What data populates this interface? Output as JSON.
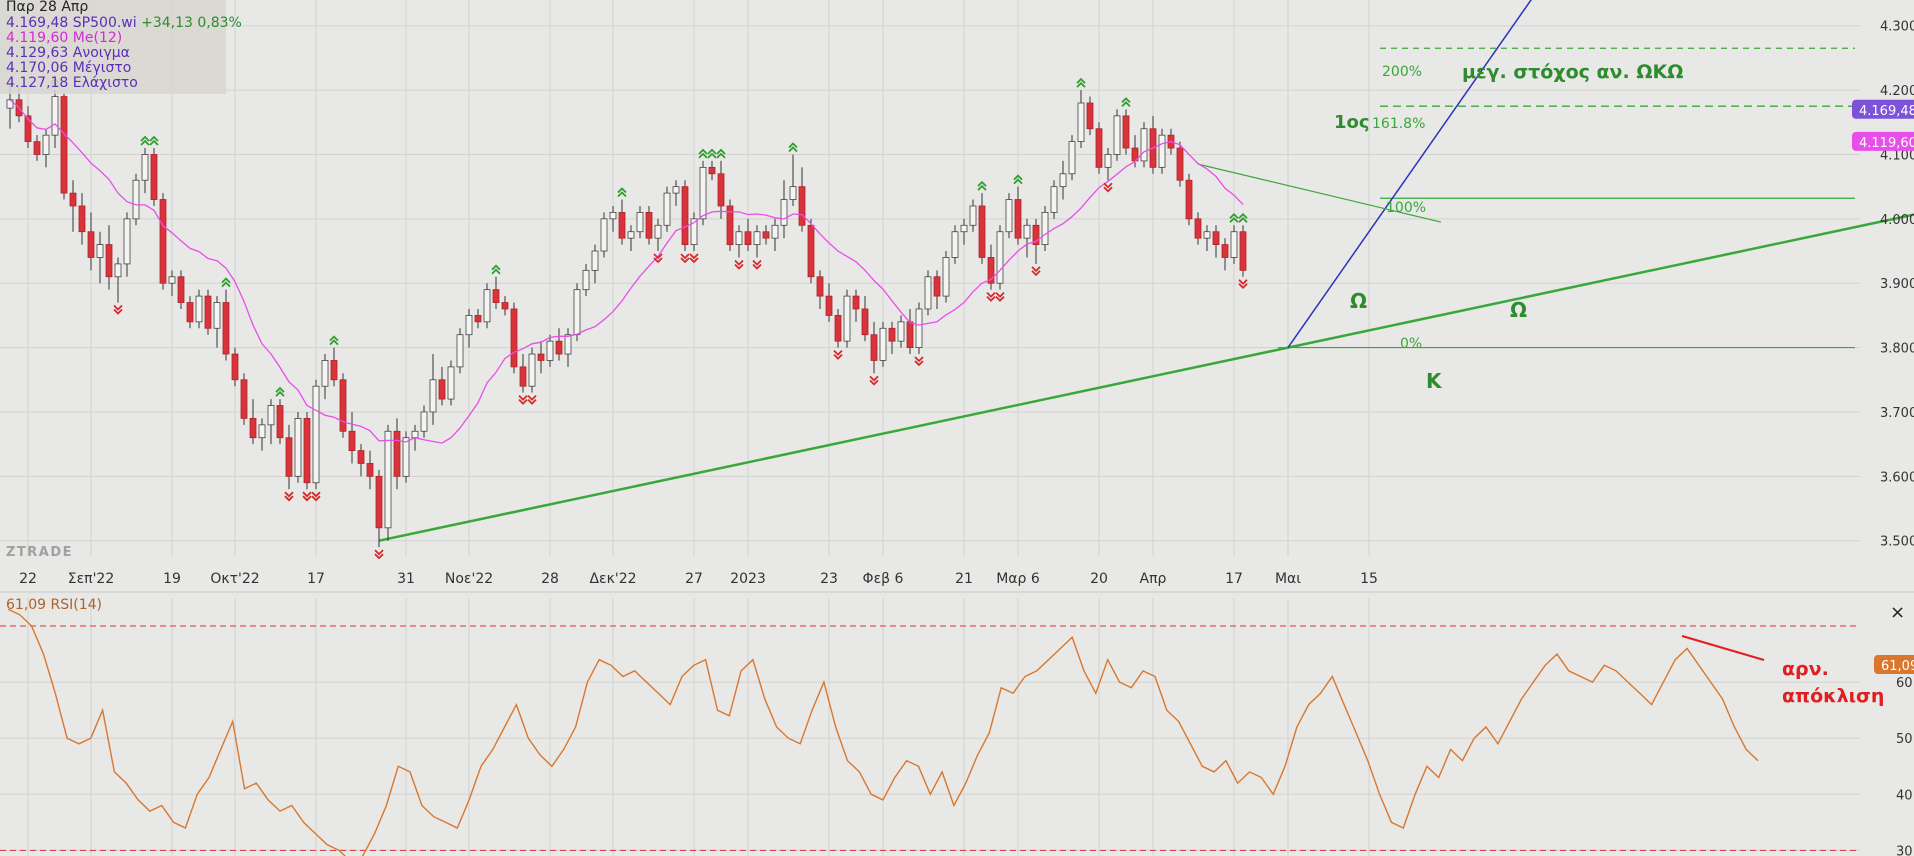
{
  "legend": {
    "date": "Παρ 28 Απρ",
    "price_line": "4.169,48 SP500.wi",
    "change": "+34,13 0,83%",
    "ma_line": "4.119,60 Me(12)",
    "open_line": "4.129,63 Ανοιγμα",
    "high_line": "4.170,06 Μέγιστο",
    "low_line": "4.127,18 Ελάχιστο"
  },
  "watermark": "ZTRADE",
  "price_badges": {
    "last": "4.169,48",
    "ma": "4.119,60"
  },
  "rsi": {
    "label": "61,09 RSI(14)",
    "badge": "61,09"
  },
  "annotations": {
    "target_label": "μεγ. στόχος αν. ΩΚΩ",
    "fib_200": "200%",
    "fib_1618_prefix": "1ος",
    "fib_1618": "161.8%",
    "fib_100": "100%",
    "fib_0": "0%",
    "omega_left": "Ω",
    "omega_right": "Ω",
    "k_label": "Κ",
    "divergence_line1": "αρν.",
    "divergence_line2": "απόκλιση"
  },
  "colors": {
    "background": "#e8e8e6",
    "bull_candle": "#f4f4f2",
    "bear_candle": "#d9343b",
    "ma": "#e84fe8",
    "rsi": "#d9772e",
    "trend_green": "#3aa73a",
    "trend_blue": "#2a34b8",
    "annotation_green": "#2e8b2e",
    "annotation_red": "#e02020",
    "badge_purple": "#7b52d8",
    "badge_pink": "#e84fe8",
    "badge_orange": "#d9772e"
  },
  "chart_data": [
    {
      "type": "candlestick",
      "series_label": "SP500.wi",
      "y_ticks": [
        "3.500",
        "3.600",
        "3.700",
        "3.800",
        "3.900",
        "4.000",
        "4.100",
        "4.200",
        "4.300"
      ],
      "y_tick_values": [
        3500,
        3600,
        3700,
        3800,
        3900,
        4000,
        4100,
        4200,
        4300
      ],
      "ylim": [
        3470,
        4340
      ],
      "x_ticks": [
        "22",
        "Σεπ'22",
        "19",
        "Οκτ'22",
        "17",
        "31",
        "Νοε'22",
        "28",
        "Δεκ'22",
        "27",
        "2023",
        "23",
        "Φεβ 6",
        "21",
        "Μαρ 6",
        "20",
        "Απρ",
        "17",
        "Μαι",
        "15"
      ],
      "x_tick_index": [
        2,
        9,
        18,
        25,
        34,
        44,
        51,
        60,
        67,
        76,
        82,
        91,
        97,
        106,
        112,
        121,
        127,
        136,
        142,
        151
      ],
      "num_sessions": 154,
      "moving_average": "Me(12)",
      "ohlc": [
        [
          4172,
          4210,
          4140,
          4185
        ],
        [
          4185,
          4205,
          4150,
          4160
        ],
        [
          4160,
          4175,
          4110,
          4120
        ],
        [
          4120,
          4130,
          4090,
          4100
        ],
        [
          4100,
          4140,
          4080,
          4130
        ],
        [
          4130,
          4200,
          4110,
          4190
        ],
        [
          4190,
          4195,
          4030,
          4040
        ],
        [
          4040,
          4060,
          3980,
          4020
        ],
        [
          4020,
          4040,
          3960,
          3980
        ],
        [
          3980,
          4010,
          3920,
          3940
        ],
        [
          3940,
          3980,
          3900,
          3960
        ],
        [
          3960,
          3990,
          3890,
          3910
        ],
        [
          3910,
          3940,
          3870,
          3930
        ],
        [
          3930,
          4010,
          3910,
          4000
        ],
        [
          4000,
          4070,
          3990,
          4060
        ],
        [
          4060,
          4110,
          4040,
          4100
        ],
        [
          4100,
          4110,
          4020,
          4030
        ],
        [
          4030,
          4040,
          3890,
          3900
        ],
        [
          3900,
          3920,
          3880,
          3910
        ],
        [
          3910,
          3920,
          3860,
          3870
        ],
        [
          3870,
          3880,
          3830,
          3840
        ],
        [
          3840,
          3890,
          3830,
          3880
        ],
        [
          3880,
          3890,
          3820,
          3830
        ],
        [
          3830,
          3880,
          3800,
          3870
        ],
        [
          3870,
          3890,
          3780,
          3790
        ],
        [
          3790,
          3800,
          3740,
          3750
        ],
        [
          3750,
          3760,
          3680,
          3690
        ],
        [
          3690,
          3720,
          3650,
          3660
        ],
        [
          3660,
          3690,
          3640,
          3680
        ],
        [
          3680,
          3720,
          3650,
          3710
        ],
        [
          3710,
          3720,
          3650,
          3660
        ],
        [
          3660,
          3680,
          3580,
          3600
        ],
        [
          3600,
          3700,
          3590,
          3690
        ],
        [
          3690,
          3700,
          3580,
          3590
        ],
        [
          3590,
          3750,
          3580,
          3740
        ],
        [
          3740,
          3790,
          3720,
          3780
        ],
        [
          3780,
          3800,
          3740,
          3750
        ],
        [
          3750,
          3760,
          3660,
          3670
        ],
        [
          3670,
          3700,
          3620,
          3640
        ],
        [
          3640,
          3650,
          3600,
          3620
        ],
        [
          3620,
          3640,
          3580,
          3600
        ],
        [
          3600,
          3610,
          3490,
          3520
        ],
        [
          3520,
          3680,
          3500,
          3670
        ],
        [
          3670,
          3690,
          3580,
          3600
        ],
        [
          3600,
          3670,
          3590,
          3660
        ],
        [
          3660,
          3680,
          3640,
          3670
        ],
        [
          3670,
          3710,
          3660,
          3700
        ],
        [
          3700,
          3790,
          3680,
          3750
        ],
        [
          3750,
          3770,
          3710,
          3720
        ],
        [
          3720,
          3780,
          3710,
          3770
        ],
        [
          3770,
          3830,
          3760,
          3820
        ],
        [
          3820,
          3860,
          3800,
          3850
        ],
        [
          3850,
          3860,
          3830,
          3840
        ],
        [
          3840,
          3900,
          3830,
          3890
        ],
        [
          3890,
          3910,
          3860,
          3870
        ],
        [
          3870,
          3880,
          3850,
          3860
        ],
        [
          3860,
          3870,
          3760,
          3770
        ],
        [
          3770,
          3790,
          3730,
          3740
        ],
        [
          3740,
          3800,
          3730,
          3790
        ],
        [
          3790,
          3810,
          3760,
          3780
        ],
        [
          3780,
          3820,
          3770,
          3810
        ],
        [
          3810,
          3830,
          3780,
          3790
        ],
        [
          3790,
          3830,
          3770,
          3820
        ],
        [
          3820,
          3900,
          3810,
          3890
        ],
        [
          3890,
          3930,
          3880,
          3920
        ],
        [
          3920,
          3960,
          3900,
          3950
        ],
        [
          3950,
          4010,
          3940,
          4000
        ],
        [
          4000,
          4020,
          3980,
          4010
        ],
        [
          4010,
          4030,
          3960,
          3970
        ],
        [
          3970,
          3990,
          3950,
          3980
        ],
        [
          3980,
          4020,
          3970,
          4010
        ],
        [
          4010,
          4020,
          3960,
          3970
        ],
        [
          3970,
          4000,
          3950,
          3990
        ],
        [
          3990,
          4050,
          3980,
          4040
        ],
        [
          4040,
          4060,
          4020,
          4050
        ],
        [
          4050,
          4060,
          3950,
          3960
        ],
        [
          3960,
          4010,
          3950,
          4000
        ],
        [
          4000,
          4090,
          3990,
          4080
        ],
        [
          4080,
          4090,
          4060,
          4070
        ],
        [
          4070,
          4090,
          4000,
          4020
        ],
        [
          4020,
          4030,
          3950,
          3960
        ],
        [
          3960,
          3990,
          3940,
          3980
        ],
        [
          3980,
          4000,
          3950,
          3960
        ],
        [
          3960,
          3990,
          3940,
          3980
        ],
        [
          3980,
          3990,
          3960,
          3970
        ],
        [
          3970,
          4000,
          3950,
          3990
        ],
        [
          3990,
          4060,
          3970,
          4030
        ],
        [
          4030,
          4100,
          4020,
          4050
        ],
        [
          4050,
          4080,
          3980,
          3990
        ],
        [
          3990,
          4000,
          3900,
          3910
        ],
        [
          3910,
          3920,
          3860,
          3880
        ],
        [
          3880,
          3900,
          3840,
          3850
        ],
        [
          3850,
          3860,
          3800,
          3810
        ],
        [
          3810,
          3890,
          3800,
          3880
        ],
        [
          3880,
          3890,
          3840,
          3860
        ],
        [
          3860,
          3880,
          3810,
          3820
        ],
        [
          3820,
          3840,
          3760,
          3780
        ],
        [
          3780,
          3840,
          3770,
          3830
        ],
        [
          3830,
          3840,
          3790,
          3810
        ],
        [
          3810,
          3850,
          3800,
          3840
        ],
        [
          3840,
          3860,
          3790,
          3800
        ],
        [
          3800,
          3870,
          3790,
          3860
        ],
        [
          3860,
          3920,
          3850,
          3910
        ],
        [
          3910,
          3920,
          3860,
          3880
        ],
        [
          3880,
          3950,
          3870,
          3940
        ],
        [
          3940,
          3990,
          3930,
          3980
        ],
        [
          3980,
          4000,
          3960,
          3990
        ],
        [
          3990,
          4030,
          3980,
          4020
        ],
        [
          4020,
          4040,
          3930,
          3940
        ],
        [
          3940,
          3960,
          3890,
          3900
        ],
        [
          3900,
          3990,
          3890,
          3980
        ],
        [
          3980,
          4040,
          3970,
          4030
        ],
        [
          4030,
          4050,
          3960,
          3970
        ],
        [
          3970,
          4000,
          3940,
          3990
        ],
        [
          3990,
          4000,
          3930,
          3960
        ],
        [
          3960,
          4020,
          3950,
          4010
        ],
        [
          4010,
          4060,
          4000,
          4050
        ],
        [
          4050,
          4090,
          4030,
          4070
        ],
        [
          4070,
          4130,
          4060,
          4120
        ],
        [
          4120,
          4200,
          4110,
          4180
        ],
        [
          4180,
          4190,
          4130,
          4140
        ],
        [
          4140,
          4150,
          4070,
          4080
        ],
        [
          4080,
          4110,
          4060,
          4100
        ],
        [
          4100,
          4170,
          4090,
          4160
        ],
        [
          4160,
          4170,
          4100,
          4110
        ],
        [
          4110,
          4130,
          4080,
          4090
        ],
        [
          4090,
          4150,
          4080,
          4140
        ],
        [
          4140,
          4160,
          4070,
          4080
        ],
        [
          4080,
          4140,
          4070,
          4130
        ],
        [
          4130,
          4140,
          4100,
          4110
        ],
        [
          4110,
          4120,
          4050,
          4060
        ],
        [
          4060,
          4070,
          3990,
          4000
        ],
        [
          4000,
          4010,
          3960,
          3970
        ],
        [
          3970,
          3990,
          3950,
          3980
        ],
        [
          3980,
          3990,
          3940,
          3960
        ],
        [
          3960,
          3970,
          3920,
          3940
        ],
        [
          3940,
          3990,
          3930,
          3980
        ],
        [
          3980,
          3990,
          3910,
          3920
        ]
      ]
    },
    {
      "type": "line",
      "series_label": "RSI(14)",
      "y_ticks": [
        "30",
        "40",
        "50",
        "60"
      ],
      "y_tick_values": [
        30,
        40,
        50,
        60
      ],
      "ylim": [
        29,
        75
      ],
      "rsi_values": [
        73,
        72,
        70,
        65,
        58,
        50,
        49,
        50,
        55,
        44,
        42,
        39,
        37,
        38,
        35,
        34,
        40,
        43,
        48,
        53,
        41,
        42,
        39,
        37,
        38,
        35,
        33,
        31,
        30,
        28,
        29,
        33,
        38,
        45,
        44,
        38,
        36,
        35,
        34,
        39,
        45,
        48,
        52,
        56,
        50,
        47,
        45,
        48,
        52,
        60,
        64,
        63,
        61,
        62,
        60,
        58,
        56,
        61,
        63,
        64,
        55,
        54,
        62,
        64,
        57,
        52,
        50,
        49,
        55,
        60,
        52,
        46,
        44,
        40,
        39,
        43,
        46,
        45,
        40,
        44,
        38,
        42,
        47,
        51,
        59,
        58,
        61,
        62,
        64,
        66,
        68,
        62,
        58,
        64,
        60,
        59,
        62,
        61,
        55,
        53,
        49,
        45,
        44,
        46,
        42,
        44,
        43,
        40,
        45,
        52,
        56,
        58,
        61,
        56,
        51,
        46,
        40,
        35,
        34,
        40,
        45,
        43,
        48,
        46,
        50,
        52,
        49,
        53,
        57,
        60,
        63,
        65,
        62,
        61,
        60,
        63,
        62,
        60,
        58,
        56,
        60,
        64,
        66,
        63,
        60,
        57,
        52,
        48,
        46
      ]
    }
  ]
}
